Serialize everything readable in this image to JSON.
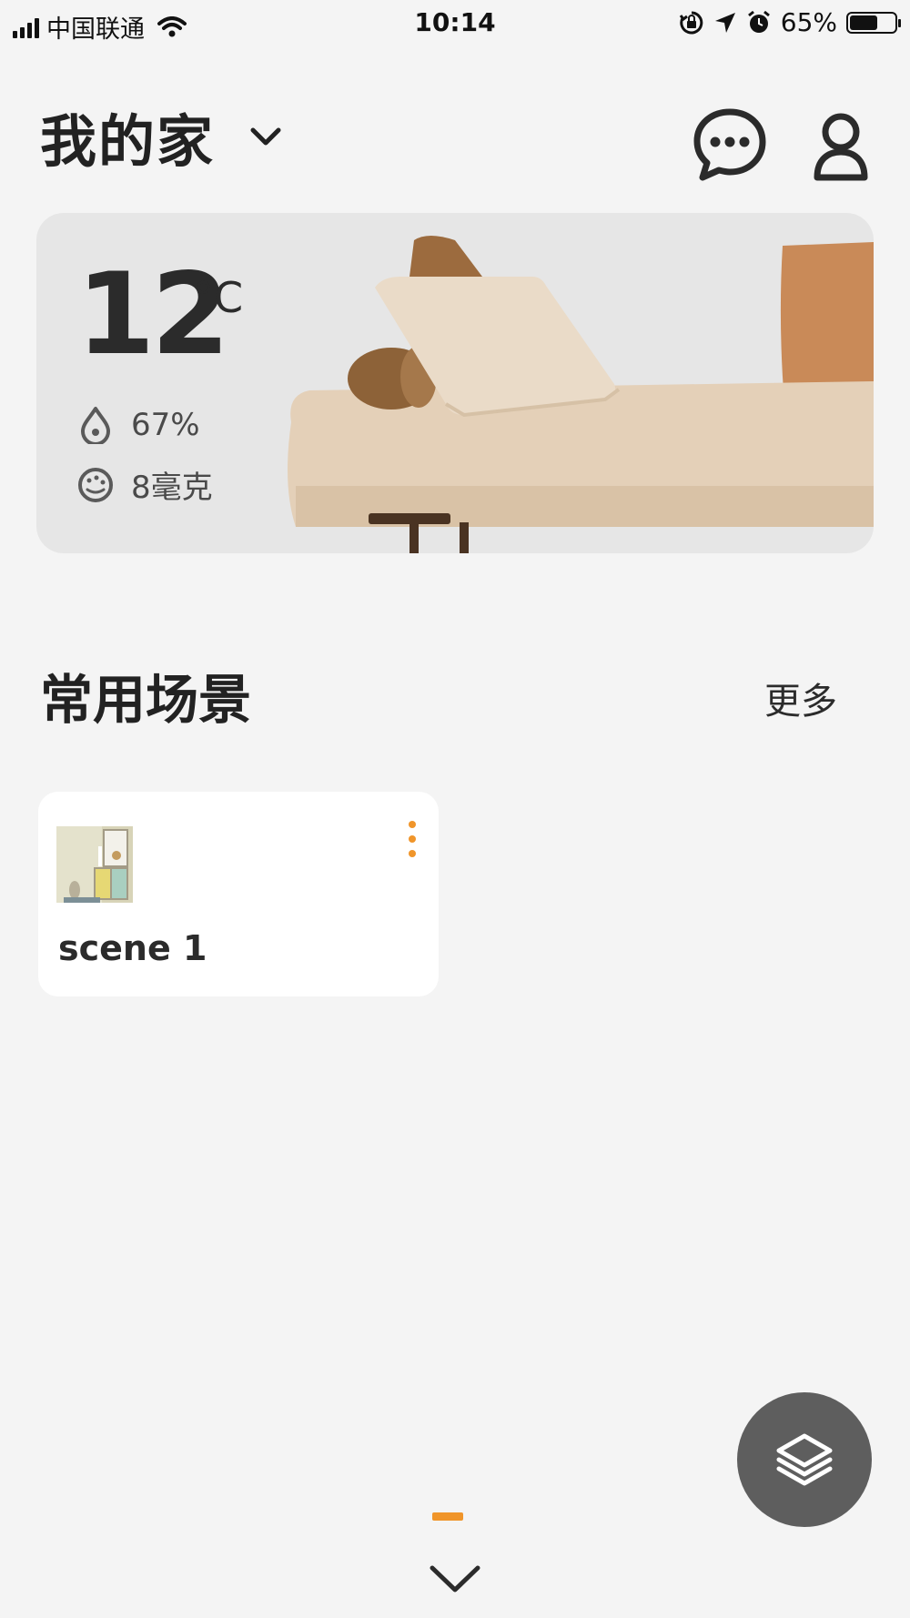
{
  "status_bar": {
    "carrier": "中国联通",
    "time": "10:14",
    "battery_percent": "65%",
    "battery_level": 0.65,
    "icons": [
      "signal-icon",
      "wifi-icon",
      "orientation-lock-icon",
      "location-icon",
      "alarm-icon",
      "battery-icon"
    ]
  },
  "header": {
    "home_name": "我的家",
    "icons": [
      "chevron-down-icon",
      "message-icon",
      "user-icon"
    ]
  },
  "weather": {
    "temperature": "12",
    "unit": "°C",
    "humidity": "67%",
    "pm": "8毫克",
    "icons": [
      "humidity-icon",
      "air-quality-icon"
    ]
  },
  "scenes": {
    "title": "常用场景",
    "more_label": "更多",
    "items": [
      {
        "name": "scene 1",
        "icon": "scene-thumbnail"
      }
    ]
  },
  "controls": {
    "fab_icon": "layers-icon",
    "collapse_icon": "chevron-down-icon"
  },
  "colors": {
    "accent": "#f0952a",
    "background": "#f4f4f4",
    "fab": "#5e5e5e",
    "text": "#2b2b2b"
  }
}
